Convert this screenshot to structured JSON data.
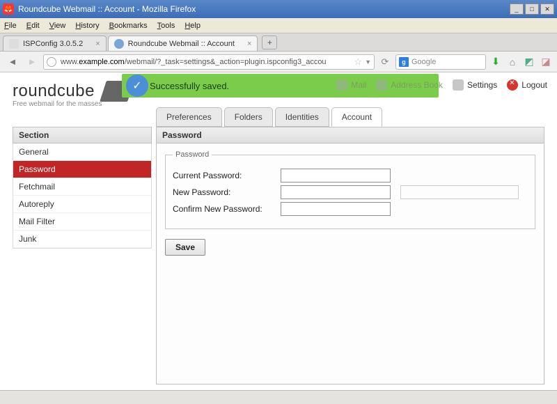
{
  "window": {
    "title": "Roundcube Webmail :: Account - Mozilla Firefox"
  },
  "menus": {
    "file": "File",
    "edit": "Edit",
    "view": "View",
    "history": "History",
    "bookmarks": "Bookmarks",
    "tools": "Tools",
    "help": "Help"
  },
  "tabs": {
    "t1": {
      "label": "ISPConfig 3.0.5.2"
    },
    "t2": {
      "label": "Roundcube Webmail :: Account"
    }
  },
  "url": {
    "pre": "www.",
    "domain": "example.com",
    "path": "/webmail/?_task=settings&_action=plugin.ispconfig3_accou"
  },
  "search": {
    "engine": "g",
    "placeholder": "Google"
  },
  "brand": {
    "name": "roundcube",
    "tagline": "Free webmail for the masses"
  },
  "message": {
    "text": "Successfully saved."
  },
  "toolbar": {
    "mail": "Mail",
    "address": "Address Book",
    "settings": "Settings",
    "logout": "Logout"
  },
  "subtabs": {
    "pref": "Preferences",
    "fold": "Folders",
    "ident": "Identities",
    "acct": "Account"
  },
  "section": {
    "title": "Section",
    "items": [
      "General",
      "Password",
      "Fetchmail",
      "Autoreply",
      "Mail Filter",
      "Junk"
    ],
    "selected": 1
  },
  "panel": {
    "title": "Password",
    "legend": "Password",
    "fields": {
      "current": "Current Password:",
      "newp": "New Password:",
      "confirm": "Confirm New Password:"
    },
    "save": "Save"
  }
}
